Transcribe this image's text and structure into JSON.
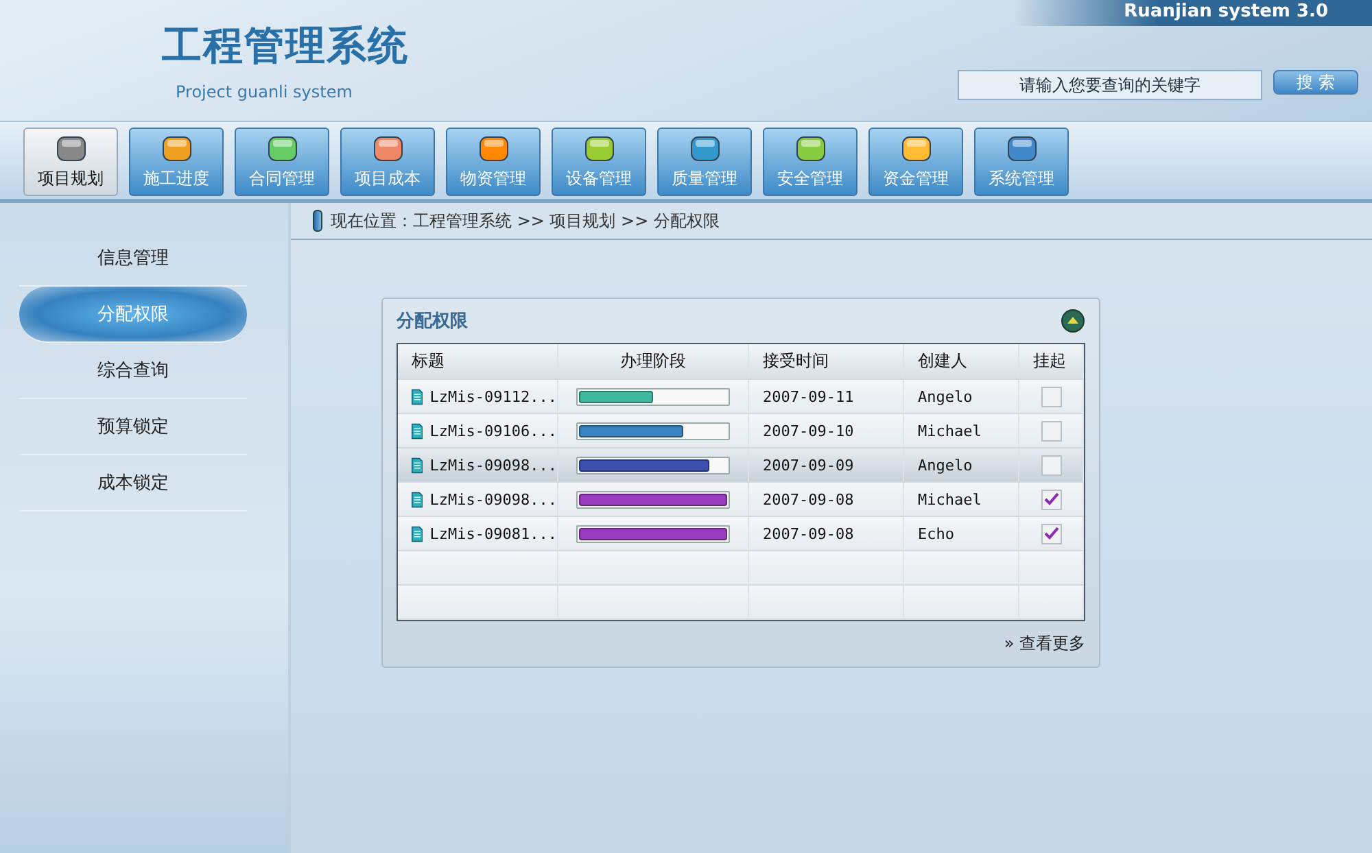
{
  "header": {
    "title": "工程管理系统",
    "subtitle": "Project guanli system",
    "version": "Ruanjian system 3.0",
    "search": {
      "placeholder": "请输入您要查询的关键字",
      "button": "搜 索"
    }
  },
  "nav": [
    {
      "label": "项目规划",
      "selected": true
    },
    {
      "label": "施工进度",
      "selected": false
    },
    {
      "label": "合同管理",
      "selected": false
    },
    {
      "label": "项目成本",
      "selected": false
    },
    {
      "label": "物资管理",
      "selected": false
    },
    {
      "label": "设备管理",
      "selected": false
    },
    {
      "label": "质量管理",
      "selected": false
    },
    {
      "label": "安全管理",
      "selected": false
    },
    {
      "label": "资金管理",
      "selected": false
    },
    {
      "label": "系统管理",
      "selected": false
    }
  ],
  "sidebar": {
    "items": [
      {
        "label": "信息管理",
        "selected": false
      },
      {
        "label": "分配权限",
        "selected": true
      },
      {
        "label": "综合查询",
        "selected": false
      },
      {
        "label": "预算锁定",
        "selected": false
      },
      {
        "label": "成本锁定",
        "selected": false
      }
    ]
  },
  "breadcrumb": "现在位置：工程管理系统 >> 项目规划 >> 分配权限",
  "panel": {
    "title": "分配权限",
    "columns": [
      "标题",
      "办理阶段",
      "接受时间",
      "创建人",
      "挂起"
    ],
    "rows": [
      {
        "title": "LzMis-09112...",
        "level": 0.5,
        "color": "#3fb8a0",
        "date": "2007-09-11",
        "creator": "Angelo",
        "checked": false,
        "selected": false
      },
      {
        "title": "LzMis-09106...",
        "level": 0.7,
        "color": "#3a82c0",
        "date": "2007-09-10",
        "creator": "Michael",
        "checked": false,
        "selected": false
      },
      {
        "title": "LzMis-09098...",
        "level": 0.88,
        "color": "#3a4fb0",
        "date": "2007-09-09",
        "creator": "Angelo",
        "checked": false,
        "selected": true
      },
      {
        "title": "LzMis-09098...",
        "level": 1,
        "color": "#9a3cc0",
        "date": "2007-09-08",
        "creator": "Michael",
        "checked": true,
        "selected": false
      },
      {
        "title": "LzMis-09081...",
        "level": 1,
        "color": "#9a3cc0",
        "date": "2007-09-08",
        "creator": "Echo",
        "checked": true,
        "selected": false
      }
    ],
    "more": "» 查看更多"
  }
}
